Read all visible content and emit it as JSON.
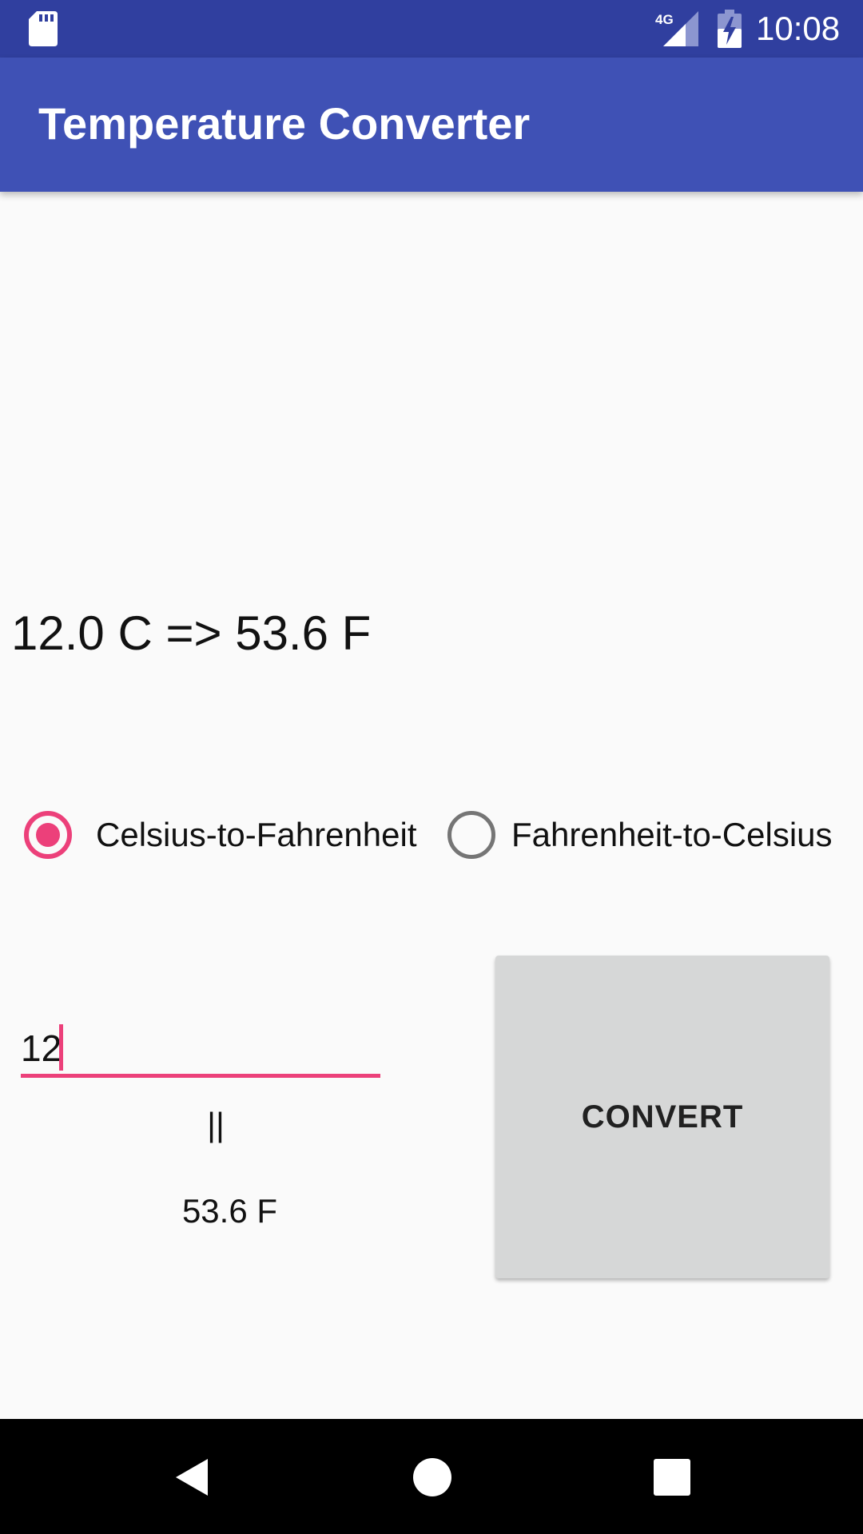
{
  "status_bar": {
    "network": "4G",
    "time": "10:08",
    "icons": [
      "sd-card-icon",
      "signal-icon",
      "battery-charging-icon"
    ]
  },
  "app_bar": {
    "title": "Temperature Converter"
  },
  "result": {
    "text": "12.0 C => 53.6 F"
  },
  "mode": {
    "options": [
      {
        "label": "Celsius-to-Fahrenheit",
        "checked": true
      },
      {
        "label": "Fahrenheit-to-Celsius",
        "checked": false
      }
    ]
  },
  "input": {
    "value": "12"
  },
  "separator": "||",
  "output": {
    "value": "53.6 F"
  },
  "button": {
    "label": "CONVERT"
  },
  "colors": {
    "primary": "#3f51b5",
    "primary_dark": "#303f9f",
    "accent": "#ec407a",
    "button_bg": "#d6d7d7"
  },
  "nav_bar": {
    "icons": [
      "back-icon",
      "home-icon",
      "recents-icon"
    ]
  }
}
